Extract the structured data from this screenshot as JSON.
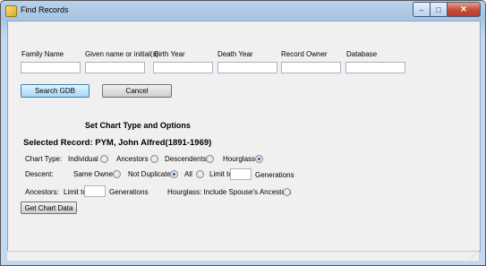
{
  "window": {
    "title": "Find Records"
  },
  "search": {
    "fields": [
      {
        "label": "Family Name",
        "value": ""
      },
      {
        "label": "Given name or initial(s)",
        "value": ""
      },
      {
        "label": "Birth Year",
        "value": ""
      },
      {
        "label": "Death Year",
        "value": ""
      },
      {
        "label": "Record Owner",
        "value": ""
      },
      {
        "label": "Database",
        "value": ""
      }
    ],
    "search_button": "Search GDB",
    "cancel_button": "Cancel"
  },
  "chart": {
    "section_title": "Set Chart Type and Options",
    "selected_record": "Selected Record: PYM, John Alfred(1891-1969)",
    "chart_type_label": "Chart Type:",
    "chart_types": [
      {
        "label": "Individual",
        "selected": false
      },
      {
        "label": "Ancestors",
        "selected": false
      },
      {
        "label": "Descendents",
        "selected": false
      },
      {
        "label": "Hourglass",
        "selected": true
      }
    ],
    "descent_label": "Descent:",
    "descent_options": [
      {
        "label": "Same Owner",
        "selected": false
      },
      {
        "label": "Not Duplicate",
        "selected": true
      },
      {
        "label": "All",
        "selected": false
      },
      {
        "label": "Limit to",
        "selected": false
      }
    ],
    "descent_limit_value": "",
    "descent_generations_label": "Generations",
    "ancestors_label": "Ancestors:",
    "ancestors_limit_label": "Limit to",
    "ancestors_limit_value": "",
    "ancestors_generations_label": "Generations",
    "hourglass_option_label": "Hourglass: Include Spouse's Ancestors",
    "hourglass_option_selected": false,
    "get_chart_button": "Get Chart Data"
  }
}
